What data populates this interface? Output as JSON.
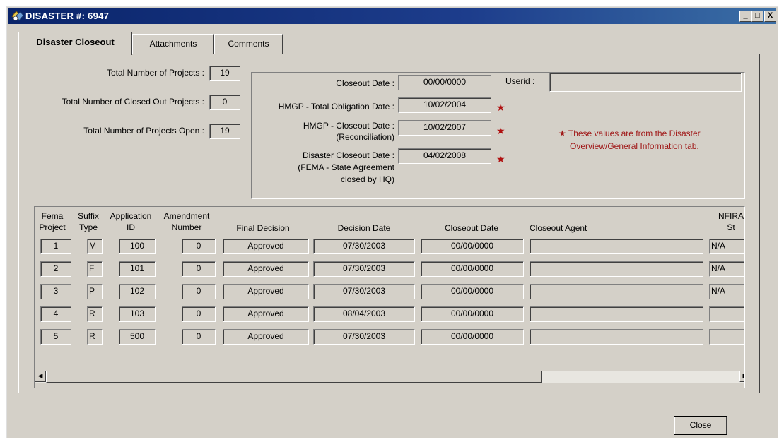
{
  "window": {
    "title": "DISASTER #: 6947",
    "minimize": "_",
    "maximize": "□",
    "close": "X"
  },
  "tabs": [
    {
      "label": "Disaster Closeout",
      "active": true
    },
    {
      "label": "Attachments",
      "active": false
    },
    {
      "label": "Comments",
      "active": false
    }
  ],
  "summary": {
    "total_projects_label": "Total Number of Projects :",
    "total_projects": "19",
    "closed_projects_label": "Total Number of Closed Out Projects :",
    "closed_projects": "0",
    "open_projects_label": "Total Number of Projects Open :",
    "open_projects": "19"
  },
  "dates": {
    "closeout_date_label": "Closeout Date :",
    "closeout_date": "00/00/0000",
    "userid_label": "Userid :",
    "userid": "",
    "hmgp_obligation_label": "HMGP - Total Obligation Date :",
    "hmgp_obligation": "10/02/2004",
    "hmgp_closeout_label_1": "HMGP - Closeout Date :",
    "hmgp_closeout_label_2": "(Reconciliation)",
    "hmgp_closeout": "10/02/2007",
    "disaster_closeout_label_1": "Disaster Closeout Date :",
    "disaster_closeout_label_2": "(FEMA - State Agreement",
    "disaster_closeout_label_3": "closed by HQ)",
    "disaster_closeout": "04/02/2008",
    "star": "★",
    "note_line1": "★ These values are from the Disaster",
    "note_line2": "Overview/General Information tab."
  },
  "grid": {
    "headers": {
      "fema_1": "Fema",
      "fema_2": "Project",
      "suffix_1": "Suffix",
      "suffix_2": "Type",
      "app_1": "Application",
      "app_2": "ID",
      "amend_1": "Amendment",
      "amend_2": "Number",
      "final": "Final Decision",
      "decision_date": "Decision Date",
      "closeout_date": "Closeout Date",
      "agent": "Closeout Agent",
      "nfira_1": "NFIRA",
      "nfira_2": "St"
    },
    "rows": [
      {
        "project": "1",
        "suffix": "M",
        "app_id": "100",
        "amend": "0",
        "final": "Approved",
        "decision_date": "07/30/2003",
        "closeout_date": "00/00/0000",
        "agent": "",
        "nfira": "N/A"
      },
      {
        "project": "2",
        "suffix": "F",
        "app_id": "101",
        "amend": "0",
        "final": "Approved",
        "decision_date": "07/30/2003",
        "closeout_date": "00/00/0000",
        "agent": "",
        "nfira": "N/A"
      },
      {
        "project": "3",
        "suffix": "P",
        "app_id": "102",
        "amend": "0",
        "final": "Approved",
        "decision_date": "07/30/2003",
        "closeout_date": "00/00/0000",
        "agent": "",
        "nfira": "N/A"
      },
      {
        "project": "4",
        "suffix": "R",
        "app_id": "103",
        "amend": "0",
        "final": "Approved",
        "decision_date": "08/04/2003",
        "closeout_date": "00/00/0000",
        "agent": "",
        "nfira": ""
      },
      {
        "project": "5",
        "suffix": "R",
        "app_id": "500",
        "amend": "0",
        "final": "Approved",
        "decision_date": "07/30/2003",
        "closeout_date": "00/00/0000",
        "agent": "",
        "nfira": ""
      }
    ]
  },
  "scroll": {
    "up": "▲",
    "down": "▼",
    "left": "◀",
    "right": "▶"
  },
  "close_button": "Close"
}
